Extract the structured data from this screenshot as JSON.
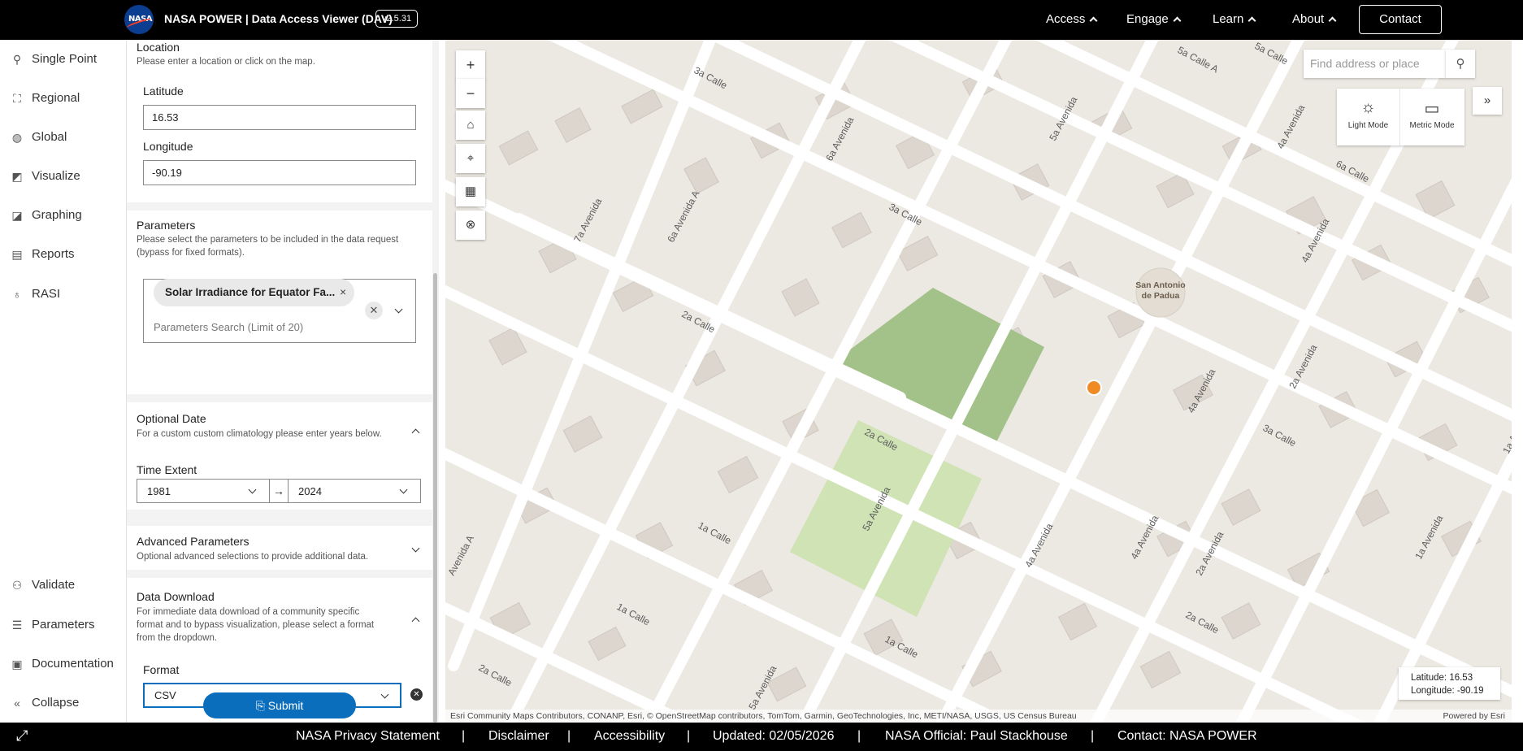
{
  "header": {
    "logo_text": "NASA",
    "title": "NASA POWER | Data Access Viewer (DAV)",
    "version": "v2.5.31",
    "nav": [
      "Access",
      "Engage",
      "Learn",
      "About"
    ],
    "contact": "Contact"
  },
  "leftnav": {
    "top_items": [
      {
        "label": "Single Point",
        "icon": "pin-icon"
      },
      {
        "label": "Regional",
        "icon": "region-icon"
      },
      {
        "label": "Global",
        "icon": "globe-icon"
      },
      {
        "label": "Visualize",
        "icon": "chart-icon"
      },
      {
        "label": "Graphing",
        "icon": "graph-icon"
      },
      {
        "label": "Reports",
        "icon": "report-icon"
      },
      {
        "label": "RASI",
        "icon": "bulb-icon"
      }
    ],
    "bottom_items": [
      {
        "label": "Validate",
        "icon": "validate-icon"
      },
      {
        "label": "Parameters",
        "icon": "list-icon"
      },
      {
        "label": "Documentation",
        "icon": "document-icon"
      },
      {
        "label": "Collapse",
        "icon": "collapse-icon"
      }
    ]
  },
  "location": {
    "title": "Location",
    "description": "Please enter a location or click on the map.",
    "latitude_label": "Latitude",
    "latitude_value": "16.53",
    "longitude_label": "Longitude",
    "longitude_value": "-90.19"
  },
  "parameters": {
    "title": "Parameters",
    "description_line1": "Please select the parameters to be included in the data request",
    "description_line2": "(bypass for fixed formats).",
    "chip": "Solar Irradiance for Equator Fa...",
    "search_placeholder": "Parameters Search (Limit of 20)"
  },
  "optional_date": {
    "title": "Optional Date",
    "description": "For a custom custom climatology please enter years below.",
    "time_extent_label": "Time Extent",
    "start_year": "1981",
    "end_year": "2024"
  },
  "advanced": {
    "title": "Advanced Parameters",
    "description": "Optional advanced selections to provide additional data."
  },
  "download": {
    "title": "Data Download",
    "description_line1": "For immediate data download of a community specific",
    "description_line2": "format and to bypass visualization, please select a format",
    "description_line3": "from the dropdown.",
    "format_label": "Format",
    "format_value": "CSV",
    "submit": "Submit"
  },
  "map": {
    "search_placeholder": "Find address or place",
    "light_mode": "Light Mode",
    "metric_mode": "Metric Mode",
    "coord_lat": "Latitude: 16.53",
    "coord_lon": "Longitude: -90.19",
    "attribution": "Esri Community Maps Contributors, CONANP, Esri, © OpenStreetMap contributors, TomTom, Garmin, GeoTechnologies, Inc, METI/NASA, USGS, US Census Bureau",
    "powered_by": "Powered by Esri",
    "landmark": "San Antonio de Padua",
    "marker_color": "#f08a24"
  },
  "footer": {
    "items": [
      "NASA Privacy Statement",
      "Disclaimer",
      "Accessibility",
      "Updated: 02/05/2026",
      "NASA Official: Paul Stackhouse",
      "Contact: NASA POWER"
    ]
  }
}
